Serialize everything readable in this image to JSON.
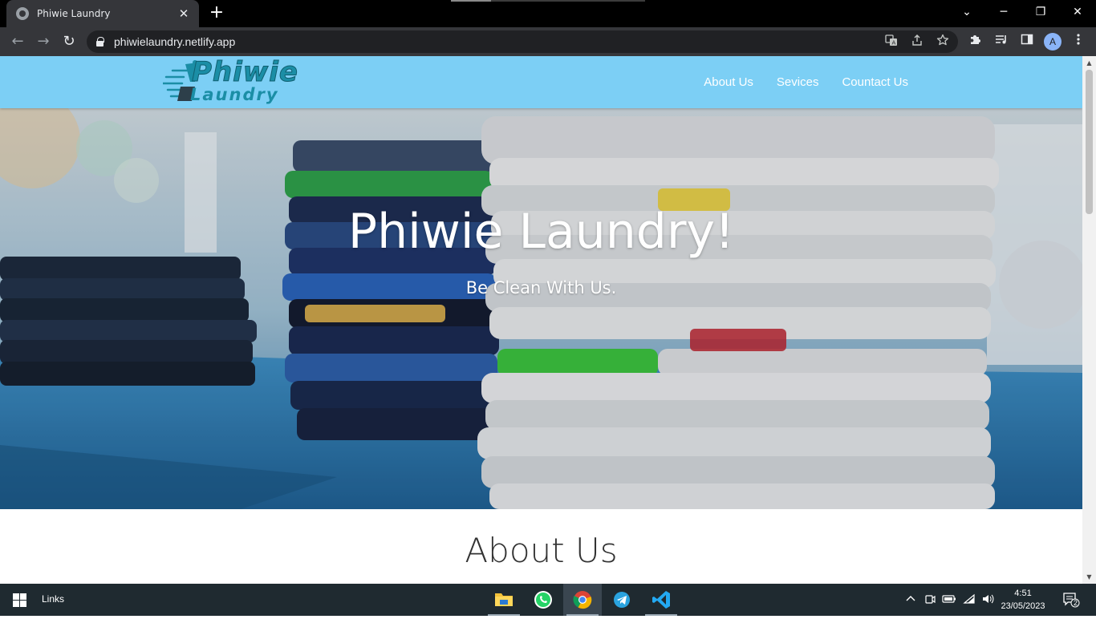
{
  "browser": {
    "tab_title": "Phiwie Laundry",
    "tab_close": "✕",
    "new_tab": "+",
    "url": "phiwielaundry.netlify.app",
    "window_controls": {
      "minimize": "─",
      "restore": "❐",
      "close": "✕",
      "tab_search": "⌄"
    },
    "nav": {
      "back": "←",
      "forward": "→",
      "reload": "↻"
    },
    "avatar_letter": "A"
  },
  "site": {
    "logo_text_top": "Phiwie",
    "logo_text_bottom": "Laundry",
    "nav_links": [
      "About Us",
      "Sevices",
      "Countact Us"
    ]
  },
  "hero": {
    "title": "Phiwie Laundry!",
    "subtitle": "Be Clean With Us."
  },
  "about": {
    "heading": "About Us"
  },
  "taskbar": {
    "links_label": "Links",
    "time": "4:51",
    "date": "23/05/2023",
    "notification_count": "2"
  },
  "colors": {
    "nav_bg": "#7ccff5",
    "logo_teal": "#1b8ea6"
  }
}
